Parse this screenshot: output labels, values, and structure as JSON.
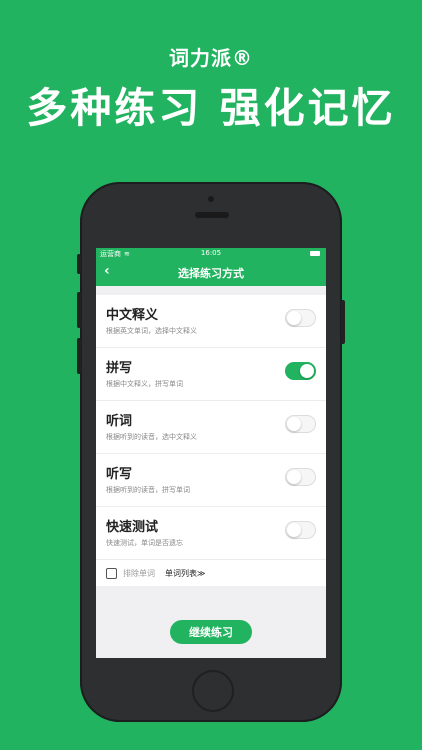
{
  "brand": "词力派®",
  "headline": "多种练习 强化记忆",
  "status": {
    "carrier": "运营商",
    "wifi_glyph": "≋",
    "time": "16:05"
  },
  "nav": {
    "back": "‹",
    "title": "选择练习方式"
  },
  "items": [
    {
      "title": "中文释义",
      "subtitle": "根据英文单词，选择中文释义",
      "enabled": false
    },
    {
      "title": "拼写",
      "subtitle": "根据中文释义，拼写单词",
      "enabled": true
    },
    {
      "title": "听词",
      "subtitle": "根据听到的读音，选中文释义",
      "enabled": false
    },
    {
      "title": "听写",
      "subtitle": "根据听到的读音，拼写单词",
      "enabled": false
    },
    {
      "title": "快速测试",
      "subtitle": "快速测试，单词是否遗忘",
      "enabled": false
    }
  ],
  "exclude": {
    "label": "排除单词",
    "checked": false
  },
  "word_list_link": "单词列表≫",
  "continue_button": "继续练习",
  "colors": {
    "accent": "#21b35f",
    "page_bg": "#21b35f",
    "screen_bg": "#f0f0f3"
  }
}
